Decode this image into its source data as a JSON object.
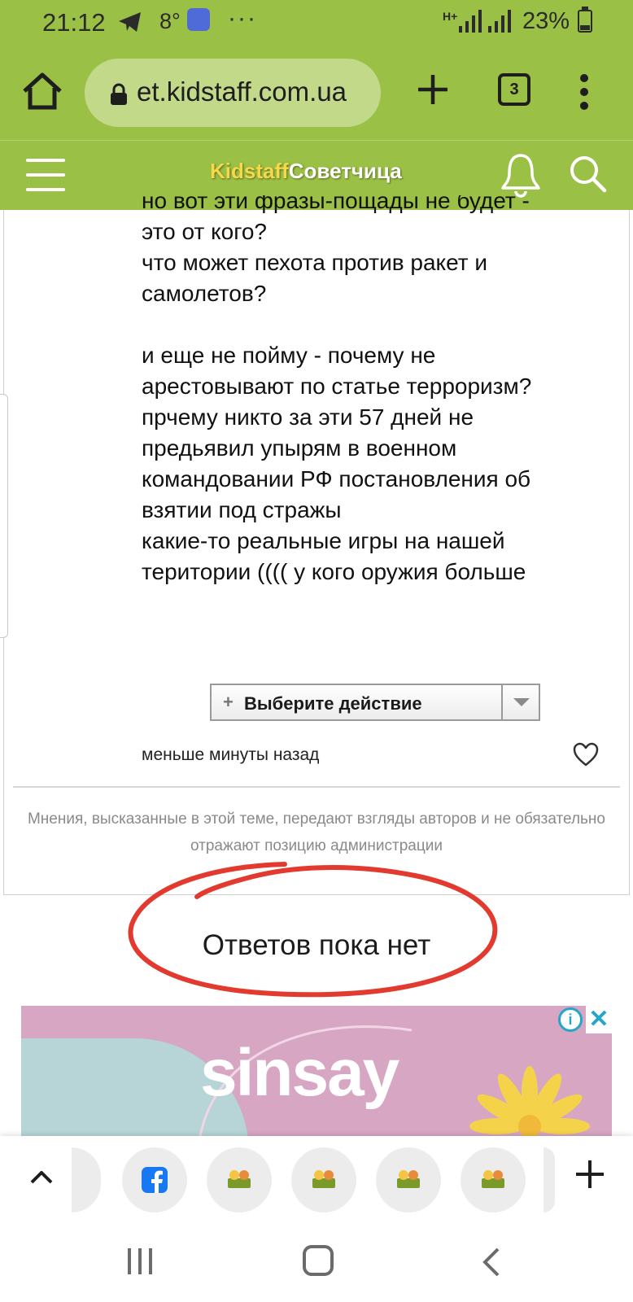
{
  "status_bar": {
    "time": "21:12",
    "temperature": "8°",
    "more": "···",
    "network_type": "H+",
    "battery_percent": "23%",
    "battery_level": 0.23
  },
  "browser": {
    "url": "et.kidstaff.com.ua",
    "tab_count": "3"
  },
  "site_header": {
    "logo_part1": "Kidstaff",
    "logo_part2": "Советчица"
  },
  "post": {
    "lines": [
      "но вот эти фразы-пощады не будет -",
      "это от кого?",
      "что может пехота против ракет и",
      "самолетов?",
      "",
      "и еще не пойму - почему не",
      "арестовывают по статье терроризм?",
      "прчему никто за эти 57 дней не",
      "предьявил упырям в военном",
      "командовании РФ постановления об",
      "взятии под стражы",
      "какие-то реальные игры на нашей",
      "територии (((( у кого оружия больше"
    ],
    "action_select": "Выберите действие",
    "timestamp": "меньше минуты назад",
    "disclaimer": "Мнения, высказанные в этой теме, передают взгляды авторов и не обязательно отражают позицию администрации"
  },
  "replies": {
    "empty_text": "Ответов пока нет"
  },
  "ad": {
    "brand": "sinsay",
    "info": "i",
    "close": "✕"
  },
  "colors": {
    "header_green": "#9bc046",
    "url_pill": "#c2d98a",
    "logo_yellow": "#f6d84a",
    "annotation_red": "#e23a2e",
    "ad_pink": "#d7a6c3",
    "ad_blue": "#b7d5d6",
    "ad_info_blue": "#25a6c9"
  },
  "icons": {
    "home": "home-icon",
    "lock": "lock-icon",
    "new_tab": "plus-icon",
    "menu": "more-vert-icon",
    "hamburger": "hamburger-icon",
    "bell": "bell-icon",
    "search": "search-icon",
    "like": "heart-icon",
    "tray_up": "chevron-up-icon",
    "facebook": "facebook-icon",
    "kidstaff": "kidstaff-site-icon",
    "tray_plus": "plus-icon",
    "recent_apps": "recent-apps-icon",
    "nav_home": "nav-home-icon",
    "nav_back": "nav-back-icon"
  }
}
